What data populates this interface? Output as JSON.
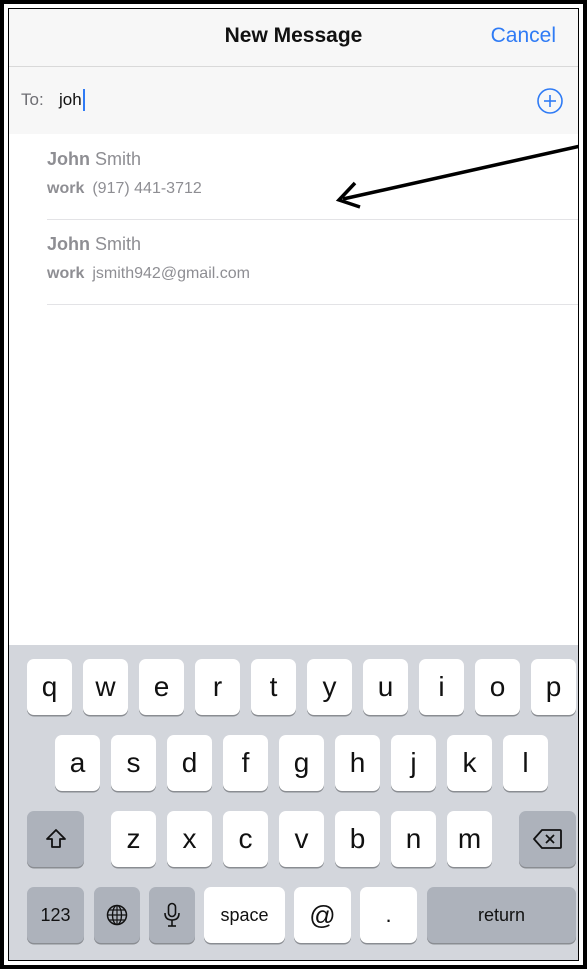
{
  "header": {
    "title": "New Message",
    "cancel_label": "Cancel"
  },
  "to_field": {
    "label": "To:",
    "value": "joh"
  },
  "suggestions": [
    {
      "match": "John",
      "rest": " Smith",
      "kind": "work",
      "detail": "(917) 441-3712"
    },
    {
      "match": "John",
      "rest": " Smith",
      "kind": "work",
      "detail": "jsmith942@gmail.com"
    }
  ],
  "keyboard": {
    "row1": [
      "q",
      "w",
      "e",
      "r",
      "t",
      "y",
      "u",
      "i",
      "o",
      "p"
    ],
    "row2": [
      "a",
      "s",
      "d",
      "f",
      "g",
      "h",
      "j",
      "k",
      "l"
    ],
    "row3": [
      "z",
      "x",
      "c",
      "v",
      "b",
      "n",
      "m"
    ],
    "numbers_label": "123",
    "space_label": "space",
    "at_label": "@",
    "period_label": ".",
    "return_label": "return"
  },
  "colors": {
    "accent": "#2f7bf5",
    "keyboard_bg": "#d3d6dc",
    "dark_key": "#adb2bb"
  }
}
